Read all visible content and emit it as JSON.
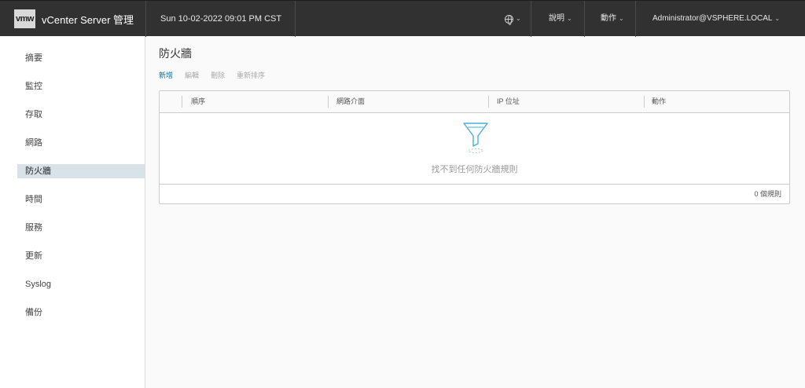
{
  "header": {
    "logo": "vmw",
    "app_title": "vCenter Server 管理",
    "datetime": "Sun 10-02-2022 09:01 PM CST",
    "help_label": "說明",
    "actions_label": "動作",
    "user": "Administrator@VSPHERE.LOCAL"
  },
  "sidebar": {
    "items": [
      {
        "label": "摘要"
      },
      {
        "label": "監控"
      },
      {
        "label": "存取"
      },
      {
        "label": "網路"
      },
      {
        "label": "防火牆"
      },
      {
        "label": "時間"
      },
      {
        "label": "服務"
      },
      {
        "label": "更新"
      },
      {
        "label": "Syslog"
      },
      {
        "label": "備份"
      }
    ],
    "active": "防火牆"
  },
  "main": {
    "title": "防火牆",
    "toolbar": {
      "add": "新增",
      "edit": "編輯",
      "delete": "刪除",
      "reorder": "重新排序"
    },
    "grid": {
      "columns": [
        "順序",
        "網路介面",
        "IP 位址",
        "動作"
      ],
      "empty_text": "找不到任何防火牆規則",
      "footer_count": "0 個規則"
    }
  },
  "colors": {
    "header_bg": "#313131",
    "active_nav_bg": "#d8e3e9",
    "link_blue": "#0072a3",
    "empty_icon": "#49afd9"
  },
  "icons": [
    "globe-icon",
    "caret-down-icon",
    "filter-funnel-icon"
  ]
}
